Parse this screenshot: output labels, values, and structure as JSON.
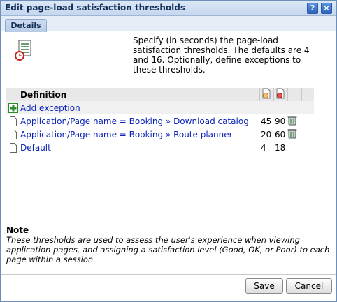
{
  "dialog": {
    "title": "Edit page-load satisfaction thresholds",
    "help_glyph": "?",
    "close_glyph": "×"
  },
  "tabs": [
    {
      "label": "Details",
      "active": true
    }
  ],
  "description": "Specify (in seconds) the page-load satisfaction thresholds. The defaults are 4 and 16. Optionally, define exceptions to these thresholds.",
  "table": {
    "header": {
      "definition": "Definition",
      "col1_icon": "satisfied-threshold-icon",
      "col2_icon": "frustrated-threshold-icon"
    },
    "add_exception_label": "Add exception",
    "rows": [
      {
        "definition": "Application/Page name = Booking » Download catalog",
        "t1": "45",
        "t2": "90",
        "deletable": true
      },
      {
        "definition": "Application/Page name = Booking » Route planner",
        "t1": "20",
        "t2": "60",
        "deletable": true
      },
      {
        "definition": "Default",
        "t1": "4",
        "t2": "18",
        "deletable": false
      }
    ]
  },
  "note": {
    "title": "Note",
    "body": "These thresholds are used to assess the user's experience when viewing application pages, and assigning a satisfaction level (Good, OK, or Poor) to each page within a session."
  },
  "buttons": {
    "save": "Save",
    "cancel": "Cancel"
  },
  "colors": {
    "link": "#0b24b8",
    "accent": "#2d62b9",
    "add": "#2e8b2e"
  }
}
